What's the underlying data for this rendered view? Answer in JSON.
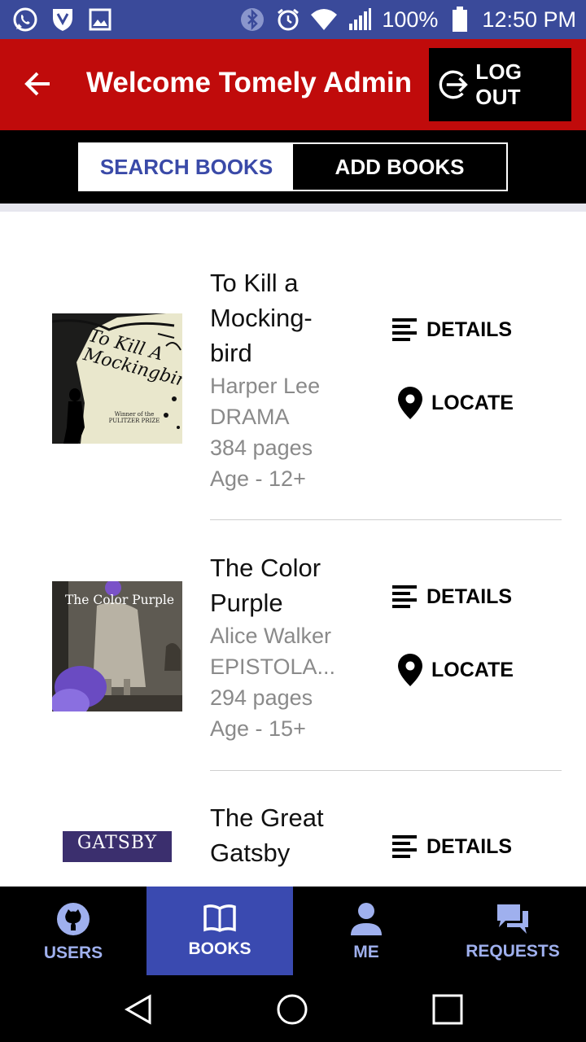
{
  "status_bar": {
    "battery": "100%",
    "time": "12:50 PM",
    "icons": [
      "whatsapp-icon",
      "vpn-shield-icon",
      "image-icon",
      "bluetooth-icon",
      "alarm-icon",
      "wifi-icon",
      "signal-icon",
      "battery-icon"
    ]
  },
  "app_bar": {
    "title": "Welcome Tomely Admin",
    "logout_label": "LOG OUT",
    "colors": {
      "background": "#c00b0b",
      "logout_bg": "#000000"
    }
  },
  "tabs": [
    {
      "label": "SEARCH BOOKS",
      "active": true
    },
    {
      "label": "ADD BOOKS",
      "active": false
    }
  ],
  "books": [
    {
      "title_lines": [
        "To Kill a",
        "Mocking-",
        "bird"
      ],
      "author": "Harper Lee",
      "genre": "DRAMA",
      "pages": "384 pages",
      "age": "Age - 12+",
      "cover_text": "To Kill A Mockingbird",
      "cover_sub": "Winner of the PULITZER PRIZE",
      "details_label": "DETAILS",
      "locate_label": "LOCATE"
    },
    {
      "title_lines": [
        "The Color",
        "Purple"
      ],
      "author": "Alice Walker",
      "genre": "EPISTOLA...",
      "pages": "294 pages",
      "age": "Age - 15+",
      "cover_text": "The Color Purple",
      "details_label": "DETAILS",
      "locate_label": "LOCATE"
    },
    {
      "title_lines": [
        "The Great",
        "Gatsby"
      ],
      "cover_text": "GATSBY",
      "details_label": "DETAILS"
    }
  ],
  "bottom_nav": [
    {
      "label": "USERS",
      "icon": "github-icon",
      "active": false
    },
    {
      "label": "BOOKS",
      "icon": "book-open-icon",
      "active": true
    },
    {
      "label": "ME",
      "icon": "person-icon",
      "active": false
    },
    {
      "label": "REQUESTS",
      "icon": "chat-icon",
      "active": false
    }
  ],
  "colors": {
    "accent": "#3a4ab0",
    "status_bar": "#3a4a9a",
    "nav_inactive": "#9fb0ee"
  }
}
